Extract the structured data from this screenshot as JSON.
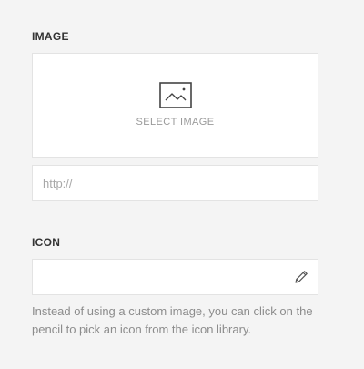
{
  "image_section": {
    "label": "IMAGE",
    "select_label": "SELECT IMAGE",
    "icon": "image-icon",
    "url_placeholder": "http://"
  },
  "icon_section": {
    "label": "ICON",
    "edit_icon": "pencil-icon",
    "help_text": "Instead of using a custom image, you can click on the pencil to pick an icon from the icon library."
  },
  "colors": {
    "background": "#f4f4f4",
    "field_background": "#ffffff",
    "border": "#e3e3e3",
    "label_text": "#333333",
    "muted_text": "#9a9a9a",
    "icon_stroke": "#444444"
  }
}
